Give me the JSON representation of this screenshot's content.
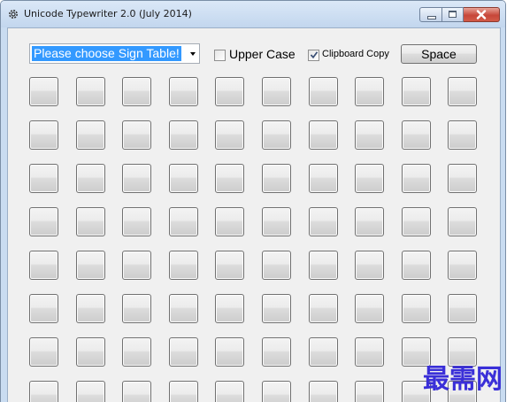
{
  "window": {
    "title": "Unicode Typewriter 2.0 (July 2014)",
    "app_icon": "gear-icon"
  },
  "toolbar": {
    "sign_table": {
      "selected": "Please choose Sign Table!"
    },
    "upper_case": {
      "label": "Upper Case",
      "checked": false
    },
    "clipboard_copy": {
      "label": "Clipboard Copy",
      "checked": true
    },
    "space_label": "Space"
  },
  "grid": {
    "rows_visible": 8,
    "columns": 10,
    "key_labels": []
  },
  "watermark": {
    "text": "最需网",
    "color": "#3a2fd8"
  },
  "colors": {
    "selection": "#3399ff",
    "window_frame": "#c9dcf1",
    "client_background": "#f0f0f0",
    "close_button": "#c7473a"
  }
}
